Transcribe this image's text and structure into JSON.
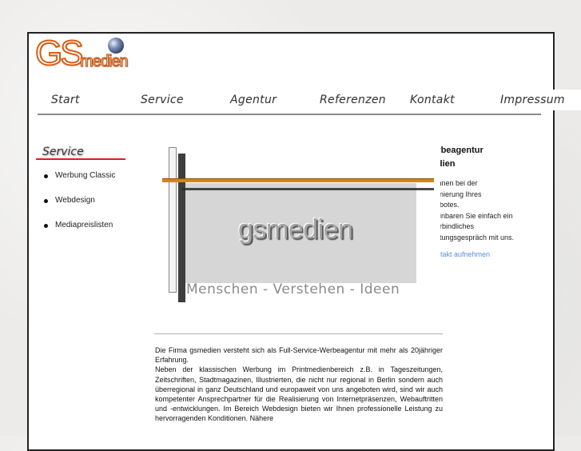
{
  "logo": {
    "main": "GS",
    "sub": "medien",
    "globe_icon": "globe-icon"
  },
  "nav": {
    "items": [
      {
        "label": "Start"
      },
      {
        "label": "Service"
      },
      {
        "label": "Agentur"
      },
      {
        "label": "Referenzen"
      },
      {
        "label": "Kontakt"
      },
      {
        "label": "Impressum"
      }
    ]
  },
  "sidebar": {
    "heading": "Service",
    "items": [
      {
        "label": "Werbung Classic"
      },
      {
        "label": "Webdesign"
      },
      {
        "label": "Mediapreislisten"
      }
    ]
  },
  "banner": {
    "word": "gsmedien",
    "slogan": "Menschen - Verstehen - Ideen"
  },
  "right": {
    "title_line1": "Werbeagentur",
    "title_line2": "medien",
    "lines": [
      "Ihnen bei der",
      "enierung Ihres",
      "ebotes.",
      "einbaren Sie einfach ein",
      "erbindliches",
      "atungsgespräch mit uns."
    ],
    "link": "takt aufnehmen"
  },
  "content": {
    "paragraph1": "Die Firma gsmedien versteht sich als Full-Service-Werbeagentur mit mehr als 20jähriger Erfahrung.",
    "paragraph2": "Neben der klassischen Werbung im Printmedienbereich z.B. in Tageszeitungen, Zeitschriften, Stadtmagazinen, Illustrierten, die nicht nur regional in Berlin sondern auch überregional in ganz Deutschland und europaweit von uns angeboten wird, sind wir auch kompetenter Ansprechpartner für die Realisierung von Internetpräsenzen, Webauftritten und -entwicklungen. Im Bereich Webdesign bieten wir Ihnen professionelle Leistung zu hervorragenden Konditionen. Nähere"
  },
  "colors": {
    "accent_orange": "#d85e14",
    "sidebar_red": "#e01b1b",
    "link_blue": "#5a8fd8"
  }
}
